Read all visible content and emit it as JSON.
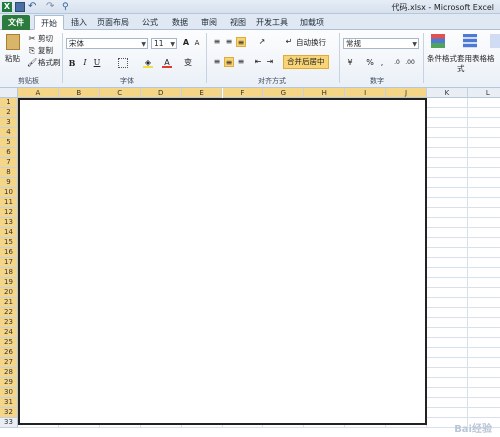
{
  "window": {
    "title": "代码.xlsx - Microsoft Excel"
  },
  "tabs": [
    "文件",
    "开始",
    "插入",
    "页面布局",
    "公式",
    "数据",
    "审阅",
    "视图",
    "开发工具",
    "加载项"
  ],
  "ribbon": {
    "clipboard": {
      "paste": "粘贴",
      "cut": "剪切",
      "copy": "复制",
      "format_painter": "格式刷",
      "group_label": "剪贴板"
    },
    "font": {
      "font_name": "宋体",
      "font_size": "11",
      "group_label": "字体",
      "bold": "B",
      "italic": "I",
      "underline": "U",
      "grow": "A",
      "shrink": "A",
      "fill_label": "A",
      "wen": "变"
    },
    "alignment": {
      "wrap_text": "自动换行",
      "merge_center": "合并后居中",
      "group_label": "对齐方式"
    },
    "number": {
      "format": "常规",
      "percent": "%",
      "comma": ",",
      "group_label": "数字"
    },
    "styles": {
      "conditional_format": "条件格式",
      "table_format": "套用表格格式"
    }
  },
  "sheet": {
    "columns": [
      "A",
      "B",
      "C",
      "D",
      "E",
      "F",
      "G",
      "H",
      "I",
      "J",
      "K",
      "L"
    ],
    "rows": [
      "1",
      "2",
      "3",
      "4",
      "5",
      "6",
      "7",
      "8",
      "9",
      "10",
      "11",
      "12",
      "13",
      "14",
      "15",
      "16",
      "17",
      "18",
      "19",
      "20",
      "21",
      "22",
      "23",
      "24",
      "25",
      "26",
      "27",
      "28",
      "29",
      "30",
      "31",
      "32",
      "33"
    ],
    "selected_range": "A1:J32"
  },
  "watermark": "Bai经验",
  "colors": {
    "file_tab": "#2a7b3d",
    "header_highlight": "#f5d586",
    "header_normal": "#e9eef5"
  }
}
